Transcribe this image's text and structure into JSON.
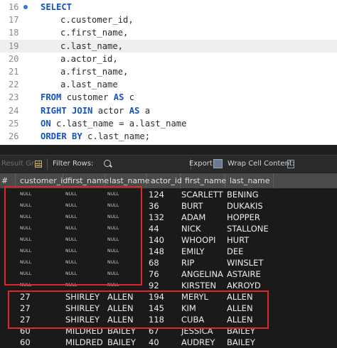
{
  "editor": {
    "lines": [
      {
        "num": "16",
        "parts": [
          [
            "kw",
            "SELECT"
          ]
        ],
        "indent": false,
        "dot": true
      },
      {
        "num": "17",
        "parts": [
          [
            "t",
            "c.customer_id,"
          ]
        ],
        "indent": true
      },
      {
        "num": "18",
        "parts": [
          [
            "t",
            "c.first_name,"
          ]
        ],
        "indent": true
      },
      {
        "num": "19",
        "parts": [
          [
            "t",
            "c.last_name,"
          ]
        ],
        "indent": true,
        "highlight": true
      },
      {
        "num": "20",
        "parts": [
          [
            "t",
            "a.actor_id,"
          ]
        ],
        "indent": true
      },
      {
        "num": "21",
        "parts": [
          [
            "t",
            "a.first_name,"
          ]
        ],
        "indent": true
      },
      {
        "num": "22",
        "parts": [
          [
            "t",
            "a.last_name"
          ]
        ],
        "indent": true
      },
      {
        "num": "23",
        "parts": [
          [
            "kw",
            "FROM"
          ],
          [
            "t",
            " customer "
          ],
          [
            "kw",
            "AS"
          ],
          [
            "t",
            " c"
          ]
        ],
        "indent": false
      },
      {
        "num": "24",
        "parts": [
          [
            "kw",
            "RIGHT JOIN"
          ],
          [
            "t",
            " actor "
          ],
          [
            "kw",
            "AS"
          ],
          [
            "t",
            " a"
          ]
        ],
        "indent": false
      },
      {
        "num": "25",
        "parts": [
          [
            "kw",
            "ON"
          ],
          [
            "t",
            " c.last_name = a.last_name"
          ]
        ],
        "indent": false
      },
      {
        "num": "26",
        "parts": [
          [
            "kw",
            "ORDER BY"
          ],
          [
            "t",
            " c.last_name;"
          ]
        ],
        "indent": false
      }
    ]
  },
  "toolbar": {
    "result_grid_label": "Result Grid",
    "filter_rows_label": "Filter Rows:",
    "export_label": "Export:",
    "wrap_cell_label": "Wrap Cell Content:"
  },
  "grid": {
    "columns": [
      "#",
      "customer_id",
      "first_name",
      "last_name",
      "actor_id",
      "first_name",
      "last_name"
    ],
    "rows": [
      [
        "NULL",
        "NULL",
        "NULL",
        "124",
        "SCARLETT",
        "BENING"
      ],
      [
        "NULL",
        "NULL",
        "NULL",
        "36",
        "BURT",
        "DUKAKIS"
      ],
      [
        "NULL",
        "NULL",
        "NULL",
        "132",
        "ADAM",
        "HOPPER"
      ],
      [
        "NULL",
        "NULL",
        "NULL",
        "44",
        "NICK",
        "STALLONE"
      ],
      [
        "NULL",
        "NULL",
        "NULL",
        "140",
        "WHOOPI",
        "HURT"
      ],
      [
        "NULL",
        "NULL",
        "NULL",
        "148",
        "EMILY",
        "DEE"
      ],
      [
        "NULL",
        "NULL",
        "NULL",
        "68",
        "RIP",
        "WINSLET"
      ],
      [
        "NULL",
        "NULL",
        "NULL",
        "76",
        "ANGELINA",
        "ASTAIRE"
      ],
      [
        "NULL",
        "NULL",
        "NULL",
        "92",
        "KIRSTEN",
        "AKROYD"
      ],
      [
        "27",
        "SHIRLEY",
        "ALLEN",
        "194",
        "MERYL",
        "ALLEN"
      ],
      [
        "27",
        "SHIRLEY",
        "ALLEN",
        "145",
        "KIM",
        "ALLEN"
      ],
      [
        "27",
        "SHIRLEY",
        "ALLEN",
        "118",
        "CUBA",
        "ALLEN"
      ],
      [
        "60",
        "MILDRED",
        "BAILEY",
        "67",
        "JESSICA",
        "BAILEY"
      ],
      [
        "60",
        "MILDRED",
        "BAILEY",
        "40",
        "AUDREY",
        "BAILEY"
      ]
    ]
  },
  "annotation_color": "#e0262b"
}
